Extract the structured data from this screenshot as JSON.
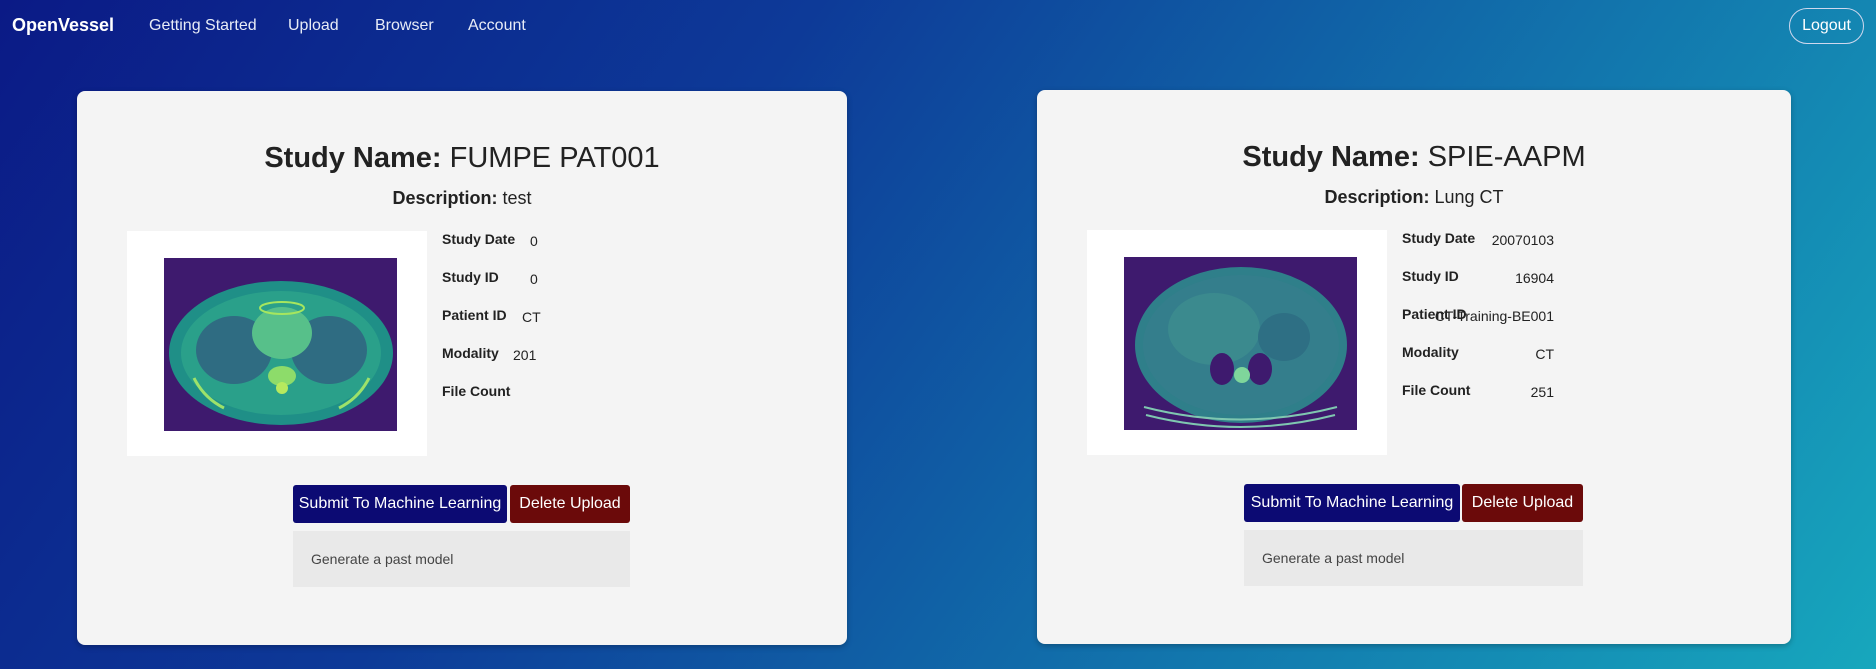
{
  "nav": {
    "brand": "OpenVessel",
    "links": [
      "Getting Started",
      "Upload",
      "Browser",
      "Account"
    ],
    "logout": "Logout"
  },
  "cards": [
    {
      "study_label": "Study Name:",
      "study_name": "FUMPE PAT001",
      "description_label": "Description:",
      "description": "test",
      "fields": [
        {
          "label": "Study Date",
          "value": "0"
        },
        {
          "label": "Study ID",
          "value": "0"
        },
        {
          "label": "Patient ID",
          "value": "CT"
        },
        {
          "label": "Modality",
          "value": "201"
        },
        {
          "label": "File Count",
          "value": ""
        }
      ],
      "submit": "Submit To Machine Learning",
      "delete": "Delete Upload",
      "past_model": "Generate a past model"
    },
    {
      "study_label": "Study Name:",
      "study_name": "SPIE-AAPM",
      "description_label": "Description:",
      "description": "Lung CT",
      "fields": [
        {
          "label": "Study Date",
          "value": "20070103"
        },
        {
          "label": "Study ID",
          "value": "16904"
        },
        {
          "label": "Patient ID",
          "value": "CT-Training-BE001"
        },
        {
          "label": "Modality",
          "value": "CT"
        },
        {
          "label": "File Count",
          "value": "251"
        }
      ],
      "submit": "Submit To Machine Learning",
      "delete": "Delete Upload",
      "past_model": "Generate a past model"
    }
  ],
  "colors": {
    "submit_button": "#0c0a73",
    "delete_button": "#6b0a0a",
    "scan_background": "#3e1a6e",
    "scan_tissue": "#1e9a8a"
  }
}
